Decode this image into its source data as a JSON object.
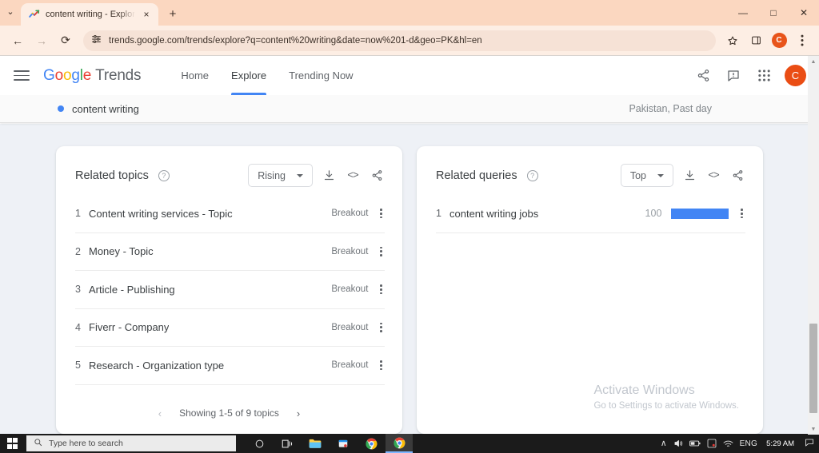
{
  "browser": {
    "tab": {
      "title": "content writing - Explore - Goo",
      "favicon_name": "google-trends-favicon",
      "close_label": "×"
    },
    "new_tab_label": "+",
    "tab_list_chevron": "⌄",
    "window_controls": {
      "minimize": "—",
      "maximize": "□",
      "close": "✕"
    },
    "nav": {
      "back": "←",
      "forward": "→",
      "reload": "⟳"
    },
    "omnibox": {
      "url": "trends.google.com/trends/explore?q=content%20writing&date=now%201-d&geo=PK&hl=en",
      "site_settings_icon": "tune-icon",
      "bookmark_icon": "star-icon",
      "sidepanel_icon": "side-panel-icon",
      "menu_icon": "three-dot-menu-icon"
    },
    "profile_initial": "C"
  },
  "trends_header": {
    "menu_icon": "hamburger-icon",
    "logo": {
      "g1": "G",
      "g2": "o",
      "g3": "o",
      "g4": "g",
      "g5": "l",
      "g6": "e",
      "product": "Trends"
    },
    "nav_items": [
      {
        "label": "Home",
        "active": false
      },
      {
        "label": "Explore",
        "active": true
      },
      {
        "label": "Trending Now",
        "active": false
      }
    ],
    "actions": [
      {
        "name": "share-icon",
        "glyph": "share"
      },
      {
        "name": "feedback-icon",
        "glyph": "feedback"
      },
      {
        "name": "google-apps-icon",
        "glyph": "apps"
      }
    ],
    "avatar_initial": "C"
  },
  "query_bar": {
    "term": "content writing",
    "term_color": "#4285f4",
    "scope": "Pakistan, Past day"
  },
  "related_topics": {
    "title": "Related topics",
    "help_glyph": "?",
    "filter": {
      "value": "Rising",
      "caret": "▾"
    },
    "tools": [
      {
        "name": "download-icon",
        "glyph": "download"
      },
      {
        "name": "embed-icon",
        "glyph": "<>"
      },
      {
        "name": "share-icon",
        "glyph": "share"
      }
    ],
    "rows": [
      {
        "rank": "1",
        "label": "Content writing services - Topic",
        "value": "Breakout"
      },
      {
        "rank": "2",
        "label": "Money - Topic",
        "value": "Breakout"
      },
      {
        "rank": "3",
        "label": "Article - Publishing",
        "value": "Breakout"
      },
      {
        "rank": "4",
        "label": "Fiverr - Company",
        "value": "Breakout"
      },
      {
        "rank": "5",
        "label": "Research - Organization type",
        "value": "Breakout"
      }
    ],
    "pager": {
      "prev": "‹",
      "text": "Showing 1-5 of 9 topics",
      "next": "›"
    }
  },
  "related_queries": {
    "title": "Related queries",
    "help_glyph": "?",
    "filter": {
      "value": "Top",
      "caret": "▾"
    },
    "tools": [
      {
        "name": "download-icon",
        "glyph": "download"
      },
      {
        "name": "embed-icon",
        "glyph": "<>"
      },
      {
        "name": "share-icon",
        "glyph": "share"
      }
    ],
    "bar_color": "#4285f4",
    "rows": [
      {
        "rank": "1",
        "label": "content writing jobs",
        "value": "100",
        "bar_pct": 100
      }
    ]
  },
  "watermark": {
    "line1": "Activate Windows",
    "line2": "Go to Settings to activate Windows."
  },
  "taskbar": {
    "start_icon": "windows-start-icon",
    "search_placeholder": "Type here to search",
    "search_icon": "search-icon",
    "apps": [
      {
        "name": "cortana-icon"
      },
      {
        "name": "task-view-icon"
      },
      {
        "name": "file-explorer-icon"
      },
      {
        "name": "microsoft-store-icon"
      },
      {
        "name": "chrome-icon"
      },
      {
        "name": "chrome-active-icon"
      }
    ],
    "tray": {
      "overflow": "∧",
      "volume_icon": "volume-icon",
      "battery_icon": "battery-icon",
      "onedrive_icon": "onedrive-icon",
      "network_icon": "wifi-icon",
      "language": "ENG",
      "time": "5:29 AM",
      "notification_icon": "action-center-icon"
    }
  }
}
